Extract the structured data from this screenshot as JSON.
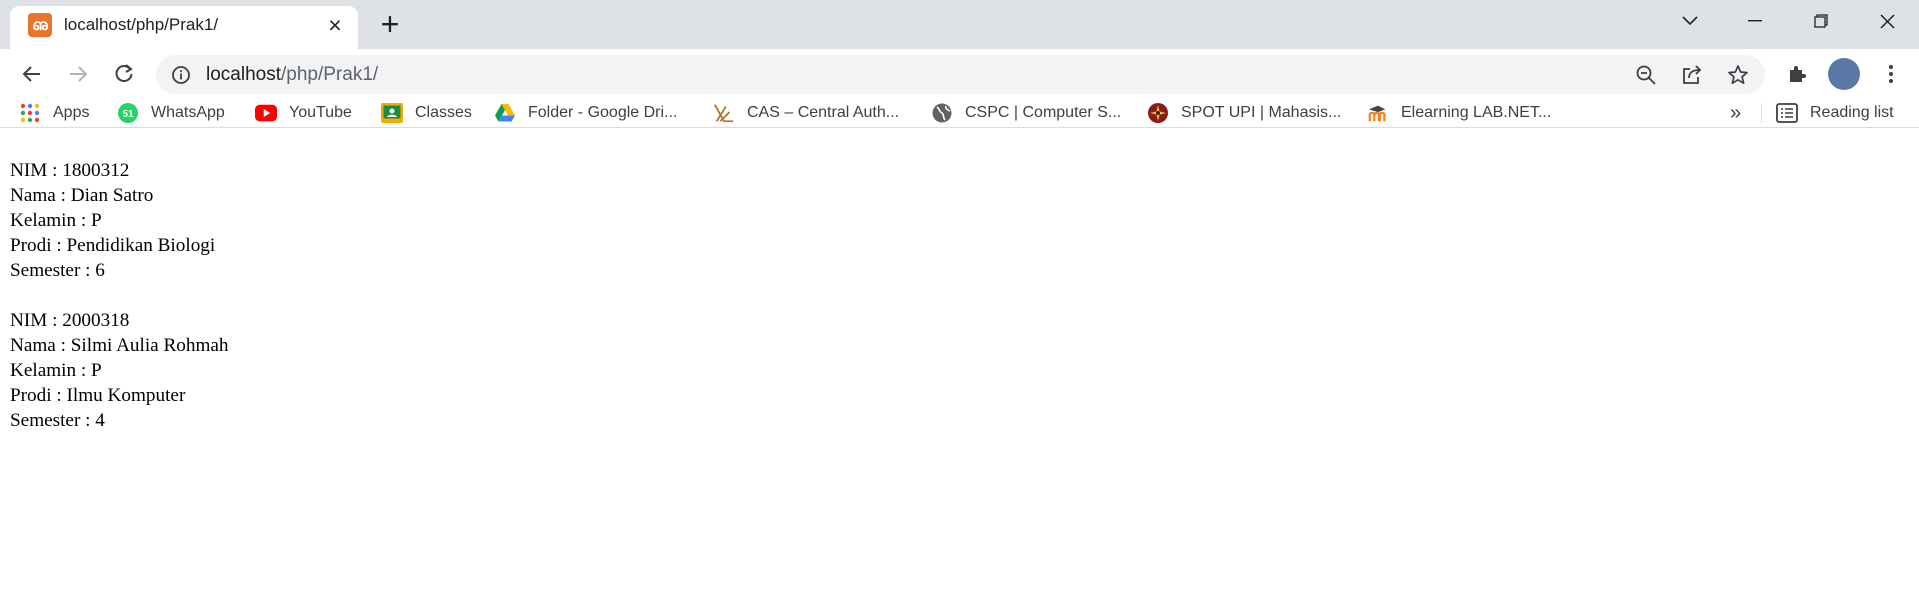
{
  "tab": {
    "title": "localhost/php/Prak1/",
    "favicon": "xampp-icon"
  },
  "address_bar": {
    "host": "localhost",
    "path": "/php/Prak1/"
  },
  "bookmarks": [
    {
      "label": "Apps",
      "icon": "apps-grid-icon"
    },
    {
      "label": "WhatsApp",
      "icon": "whatsapp-icon"
    },
    {
      "label": "YouTube",
      "icon": "youtube-icon"
    },
    {
      "label": "Classes",
      "icon": "google-classroom-icon"
    },
    {
      "label": "Folder - Google Dri...",
      "icon": "google-drive-icon"
    },
    {
      "label": "CAS – Central Auth...",
      "icon": "cas-icon"
    },
    {
      "label": "CSPC | Computer S...",
      "icon": "globe-icon"
    },
    {
      "label": "SPOT UPI | Mahasis...",
      "icon": "upi-icon"
    },
    {
      "label": "Elearning LAB.NET...",
      "icon": "moodle-icon"
    }
  ],
  "bookmarks_overflow": "»",
  "reading_list": "Reading list",
  "content": {
    "records": [
      {
        "nim": "NIM : 1800312",
        "nama": "Nama : Dian Satro",
        "kelamin": "Kelamin : P",
        "prodi": "Prodi : Pendidikan Biologi",
        "semester": "Semester : 6"
      },
      {
        "nim": "NIM : 2000318",
        "nama": "Nama : Silmi Aulia Rohmah",
        "kelamin": "Kelamin : P",
        "prodi": "Prodi : Ilmu Komputer",
        "semester": "Semester : 4"
      }
    ]
  }
}
